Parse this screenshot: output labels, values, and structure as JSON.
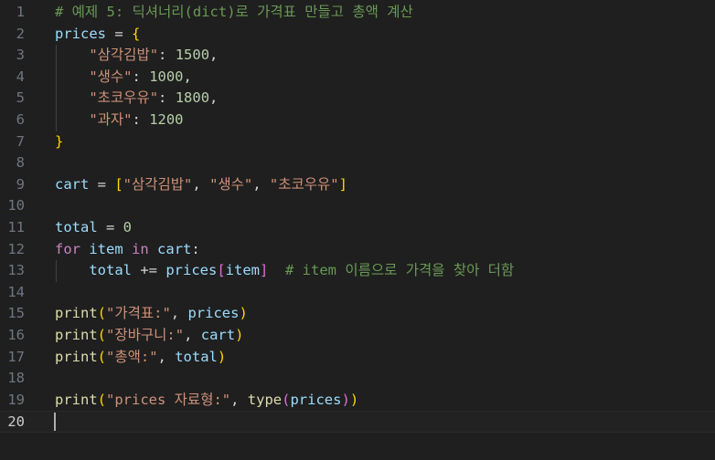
{
  "editor": {
    "active_line": 20,
    "lines": [
      {
        "n": "1",
        "tokens": [
          {
            "t": "# 예제 5: 딕셔너리(dict)로 가격표 만들고 총액 계산",
            "c": "comment"
          }
        ]
      },
      {
        "n": "2",
        "tokens": [
          {
            "t": "prices",
            "c": "var"
          },
          {
            "t": " = ",
            "c": "op"
          },
          {
            "t": "{",
            "c": "b1"
          }
        ]
      },
      {
        "n": "3",
        "tokens": [
          {
            "t": "    ",
            "c": "plain"
          },
          {
            "t": "\"삼각김밥\"",
            "c": "str"
          },
          {
            "t": ": ",
            "c": "op"
          },
          {
            "t": "1500",
            "c": "num"
          },
          {
            "t": ",",
            "c": "op"
          }
        ]
      },
      {
        "n": "4",
        "tokens": [
          {
            "t": "    ",
            "c": "plain"
          },
          {
            "t": "\"생수\"",
            "c": "str"
          },
          {
            "t": ": ",
            "c": "op"
          },
          {
            "t": "1000",
            "c": "num"
          },
          {
            "t": ",",
            "c": "op"
          }
        ]
      },
      {
        "n": "5",
        "tokens": [
          {
            "t": "    ",
            "c": "plain"
          },
          {
            "t": "\"초코우유\"",
            "c": "str"
          },
          {
            "t": ": ",
            "c": "op"
          },
          {
            "t": "1800",
            "c": "num"
          },
          {
            "t": ",",
            "c": "op"
          }
        ]
      },
      {
        "n": "6",
        "tokens": [
          {
            "t": "    ",
            "c": "plain"
          },
          {
            "t": "\"과자\"",
            "c": "str"
          },
          {
            "t": ": ",
            "c": "op"
          },
          {
            "t": "1200",
            "c": "num"
          }
        ]
      },
      {
        "n": "7",
        "tokens": [
          {
            "t": "}",
            "c": "b1"
          }
        ]
      },
      {
        "n": "8",
        "tokens": []
      },
      {
        "n": "9",
        "tokens": [
          {
            "t": "cart",
            "c": "var"
          },
          {
            "t": " = ",
            "c": "op"
          },
          {
            "t": "[",
            "c": "b1"
          },
          {
            "t": "\"삼각김밥\"",
            "c": "str"
          },
          {
            "t": ", ",
            "c": "op"
          },
          {
            "t": "\"생수\"",
            "c": "str"
          },
          {
            "t": ", ",
            "c": "op"
          },
          {
            "t": "\"초코우유\"",
            "c": "str"
          },
          {
            "t": "]",
            "c": "b1"
          }
        ]
      },
      {
        "n": "10",
        "tokens": []
      },
      {
        "n": "11",
        "tokens": [
          {
            "t": "total",
            "c": "var"
          },
          {
            "t": " = ",
            "c": "op"
          },
          {
            "t": "0",
            "c": "num"
          }
        ]
      },
      {
        "n": "12",
        "tokens": [
          {
            "t": "for",
            "c": "kw"
          },
          {
            "t": " ",
            "c": "plain"
          },
          {
            "t": "item",
            "c": "var"
          },
          {
            "t": " ",
            "c": "plain"
          },
          {
            "t": "in",
            "c": "kw"
          },
          {
            "t": " ",
            "c": "plain"
          },
          {
            "t": "cart",
            "c": "var"
          },
          {
            "t": ":",
            "c": "op"
          }
        ]
      },
      {
        "n": "13",
        "tokens": [
          {
            "t": "    ",
            "c": "plain"
          },
          {
            "t": "total",
            "c": "var"
          },
          {
            "t": " += ",
            "c": "op"
          },
          {
            "t": "prices",
            "c": "var"
          },
          {
            "t": "[",
            "c": "b2"
          },
          {
            "t": "item",
            "c": "var"
          },
          {
            "t": "]",
            "c": "b2"
          },
          {
            "t": "  ",
            "c": "plain"
          },
          {
            "t": "# item 이름으로 가격을 찾아 더함",
            "c": "comment"
          }
        ]
      },
      {
        "n": "14",
        "tokens": []
      },
      {
        "n": "15",
        "tokens": [
          {
            "t": "print",
            "c": "fn"
          },
          {
            "t": "(",
            "c": "b1"
          },
          {
            "t": "\"가격표:\"",
            "c": "str"
          },
          {
            "t": ", ",
            "c": "op"
          },
          {
            "t": "prices",
            "c": "var"
          },
          {
            "t": ")",
            "c": "b1"
          }
        ]
      },
      {
        "n": "16",
        "tokens": [
          {
            "t": "print",
            "c": "fn"
          },
          {
            "t": "(",
            "c": "b1"
          },
          {
            "t": "\"장바구니:\"",
            "c": "str"
          },
          {
            "t": ", ",
            "c": "op"
          },
          {
            "t": "cart",
            "c": "var"
          },
          {
            "t": ")",
            "c": "b1"
          }
        ]
      },
      {
        "n": "17",
        "tokens": [
          {
            "t": "print",
            "c": "fn"
          },
          {
            "t": "(",
            "c": "b1"
          },
          {
            "t": "\"총액:\"",
            "c": "str"
          },
          {
            "t": ", ",
            "c": "op"
          },
          {
            "t": "total",
            "c": "var"
          },
          {
            "t": ")",
            "c": "b1"
          }
        ]
      },
      {
        "n": "18",
        "tokens": []
      },
      {
        "n": "19",
        "tokens": [
          {
            "t": "print",
            "c": "fn"
          },
          {
            "t": "(",
            "c": "b1"
          },
          {
            "t": "\"prices 자료형:\"",
            "c": "str"
          },
          {
            "t": ", ",
            "c": "op"
          },
          {
            "t": "type",
            "c": "fn"
          },
          {
            "t": "(",
            "c": "b2"
          },
          {
            "t": "prices",
            "c": "var"
          },
          {
            "t": ")",
            "c": "b2"
          },
          {
            "t": ")",
            "c": "b1"
          }
        ]
      },
      {
        "n": "20",
        "tokens": []
      }
    ]
  }
}
